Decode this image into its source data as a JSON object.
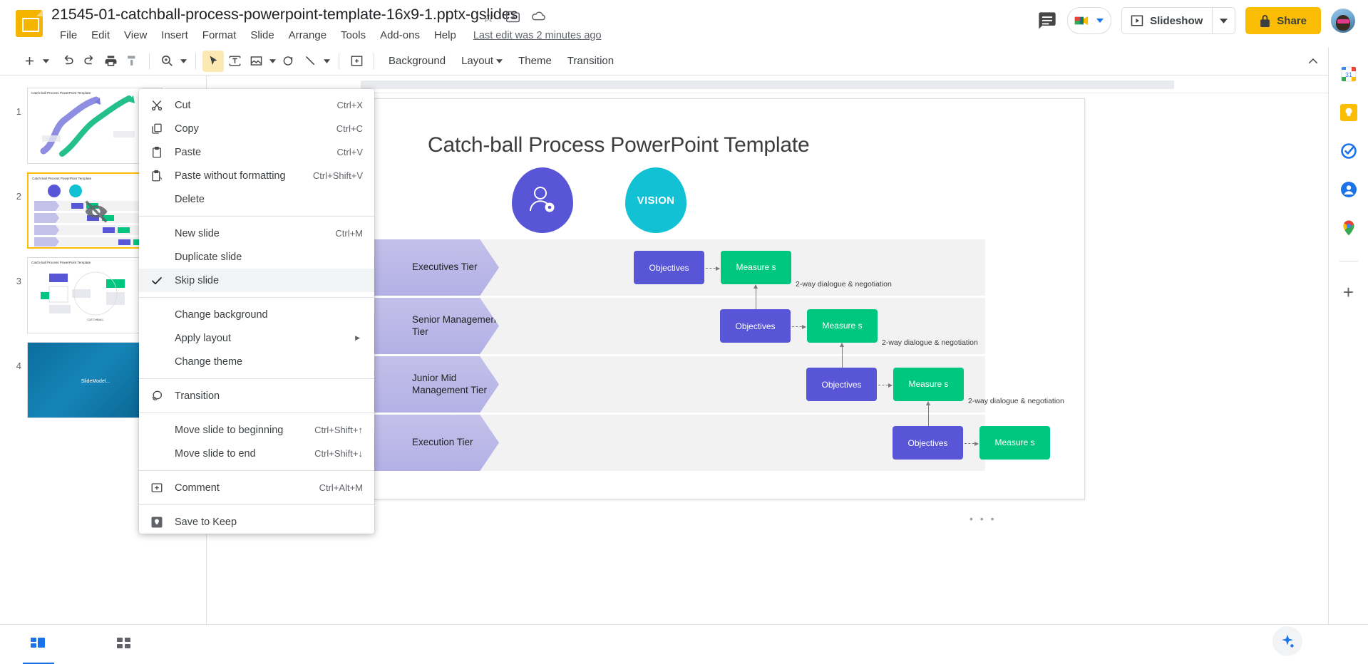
{
  "header": {
    "doc_title": "21545-01-catchball-process-powerpoint-template-16x9-1.pptx-gslides",
    "menus": [
      "File",
      "Edit",
      "View",
      "Insert",
      "Format",
      "Slide",
      "Arrange",
      "Tools",
      "Add-ons",
      "Help"
    ],
    "last_edit": "Last edit was 2 minutes ago",
    "slideshow_label": "Slideshow",
    "share_label": "Share",
    "icons": {
      "star": "star-icon",
      "move": "move-to-folder-icon",
      "cloud": "cloud-save-icon",
      "comment": "comment-history-icon",
      "meet": "google-meet-icon",
      "avatar": "account-avatar"
    }
  },
  "toolbar": {
    "background_label": "Background",
    "layout_label": "Layout",
    "theme_label": "Theme",
    "transition_label": "Transition"
  },
  "context_menu": {
    "items": [
      {
        "label": "Cut",
        "shortcut": "Ctrl+X",
        "icon": "scissors-icon",
        "type": "item"
      },
      {
        "label": "Copy",
        "shortcut": "Ctrl+C",
        "icon": "copy-icon",
        "type": "item"
      },
      {
        "label": "Paste",
        "shortcut": "Ctrl+V",
        "icon": "clipboard-icon",
        "type": "item"
      },
      {
        "label": "Paste without formatting",
        "shortcut": "Ctrl+Shift+V",
        "icon": "clipboard-text-icon",
        "type": "item"
      },
      {
        "label": "Delete",
        "shortcut": "",
        "icon": "",
        "type": "item"
      },
      {
        "type": "separator"
      },
      {
        "label": "New slide",
        "shortcut": "Ctrl+M",
        "icon": "",
        "type": "item"
      },
      {
        "label": "Duplicate slide",
        "shortcut": "",
        "icon": "",
        "type": "item"
      },
      {
        "label": "Skip slide",
        "shortcut": "",
        "icon": "check-icon",
        "type": "item",
        "checked": true,
        "highlighted": true
      },
      {
        "type": "separator"
      },
      {
        "label": "Change background",
        "shortcut": "",
        "icon": "",
        "type": "item"
      },
      {
        "label": "Apply layout",
        "shortcut": "",
        "icon": "",
        "type": "item",
        "submenu": true
      },
      {
        "label": "Change theme",
        "shortcut": "",
        "icon": "",
        "type": "item"
      },
      {
        "type": "separator"
      },
      {
        "label": "Transition",
        "shortcut": "",
        "icon": "transition-icon",
        "type": "item"
      },
      {
        "type": "separator"
      },
      {
        "label": "Move slide to beginning",
        "shortcut": "Ctrl+Shift+↑",
        "icon": "",
        "type": "item"
      },
      {
        "label": "Move slide to end",
        "shortcut": "Ctrl+Shift+↓",
        "icon": "",
        "type": "item"
      },
      {
        "type": "separator"
      },
      {
        "label": "Comment",
        "shortcut": "Ctrl+Alt+M",
        "icon": "comment-add-icon",
        "type": "item"
      },
      {
        "type": "separator"
      },
      {
        "label": "Save to Keep",
        "shortcut": "",
        "icon": "keep-icon",
        "type": "item"
      }
    ]
  },
  "filmstrip": {
    "slides": [
      {
        "number": "1",
        "title": "Catch-ball Process PowerPoint Template",
        "selected": false
      },
      {
        "number": "2",
        "title": "Catch-ball Process PowerPoint Template",
        "selected": true
      },
      {
        "number": "3",
        "title": "Catch-ball Process PowerPoint Template",
        "selected": false
      },
      {
        "number": "4",
        "title": "",
        "selected": false
      }
    ]
  },
  "slide": {
    "title": "Catch-ball Process PowerPoint Template",
    "vision_label": "VISION",
    "tiers": [
      {
        "label": "Executives Tier"
      },
      {
        "label": "Senior Management Tier"
      },
      {
        "label": "Junior Mid Management Tier"
      },
      {
        "label": "Execution Tier"
      }
    ],
    "objectives_label": "Objectives",
    "measures_label": "Measure s",
    "dialogue_notes": [
      "2-way dialogue & negotiation",
      "2-way dialogue & negotiation",
      "2-way dialogue & negotiation"
    ],
    "dots": "• • •"
  },
  "rail": {
    "icons": [
      "calendar-icon",
      "keep-icon",
      "tasks-icon",
      "contacts-icon",
      "maps-icon"
    ],
    "calendar_day": "31",
    "plus_label": "+"
  },
  "colors": {
    "accent_yellow": "#FBBC04",
    "purple": "#5856d6",
    "green": "#00c77f",
    "teal": "#12c2d4",
    "chevron": "#c3c0ea",
    "band": "#f2f2f3",
    "blue": "#1a73e8"
  }
}
